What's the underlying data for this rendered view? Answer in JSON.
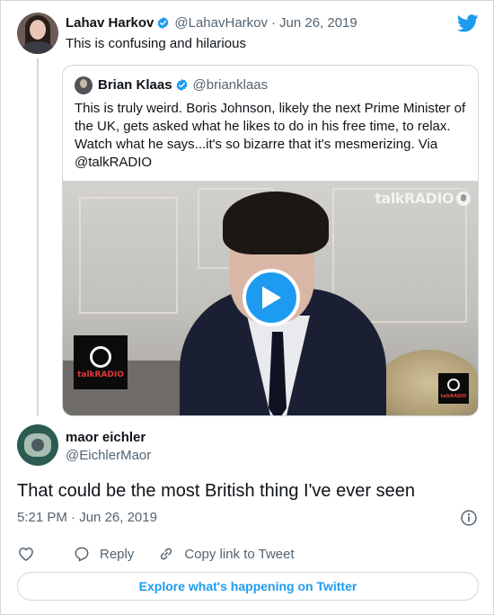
{
  "parent_tweet": {
    "author": {
      "name": "Lahav Harkov",
      "handle": "@LahavHarkov",
      "verified": true
    },
    "separator": "·",
    "date": "Jun 26, 2019",
    "text": "This is confusing and hilarious"
  },
  "quoted_tweet": {
    "author": {
      "name": "Brian Klaas",
      "handle": "@brianklaas",
      "verified": true
    },
    "text": "This is truly weird. Boris Johnson, likely the next Prime Minister of the UK, gets asked what he likes to do in his free time, to relax. Watch what he says...it's so bizarre that it's mesmerizing. Via @talkRADIO",
    "video": {
      "watermark": "talkRADIO",
      "logo_label": "talkRADIO",
      "play_icon": "play-icon"
    }
  },
  "main_tweet": {
    "author": {
      "name": "maor eichler",
      "handle": "@EichlerMaor"
    },
    "text": "That could be the most British thing I've ever seen",
    "time": "5:21 PM",
    "separator": "·",
    "date": "Jun 26, 2019"
  },
  "actions": {
    "like_icon": "heart-icon",
    "reply_label": "Reply",
    "copy_link_label": "Copy link to Tweet"
  },
  "explore_label": "Explore what's happening on Twitter",
  "colors": {
    "accent": "#1d9bf0",
    "text_primary": "#0f1419",
    "text_secondary": "#536471",
    "border": "#cfd9de"
  }
}
